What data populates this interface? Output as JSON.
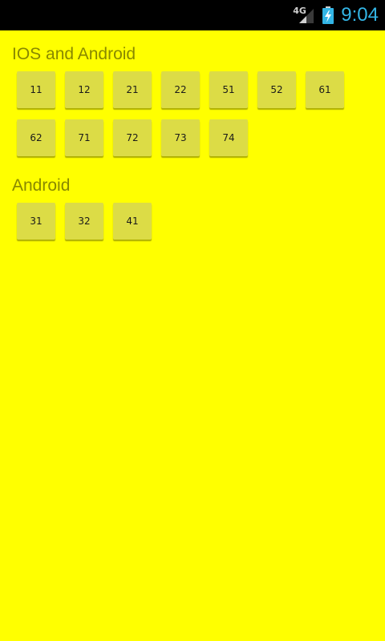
{
  "status_bar": {
    "network_type": "4G",
    "time": "9:04",
    "icons": [
      "signal-icon",
      "battery-charging-icon"
    ],
    "colors": {
      "background": "#000000",
      "clock": "#33b5e5"
    }
  },
  "sections": [
    {
      "title": "IOS and Android",
      "items": [
        "11",
        "12",
        "21",
        "22",
        "51",
        "52",
        "61",
        "62",
        "71",
        "72",
        "73",
        "74"
      ]
    },
    {
      "title": "Android",
      "items": [
        "31",
        "32",
        "41"
      ]
    }
  ],
  "colors": {
    "background": "#ffff00",
    "tile": "#dcdc46",
    "section_title": "#888800"
  }
}
